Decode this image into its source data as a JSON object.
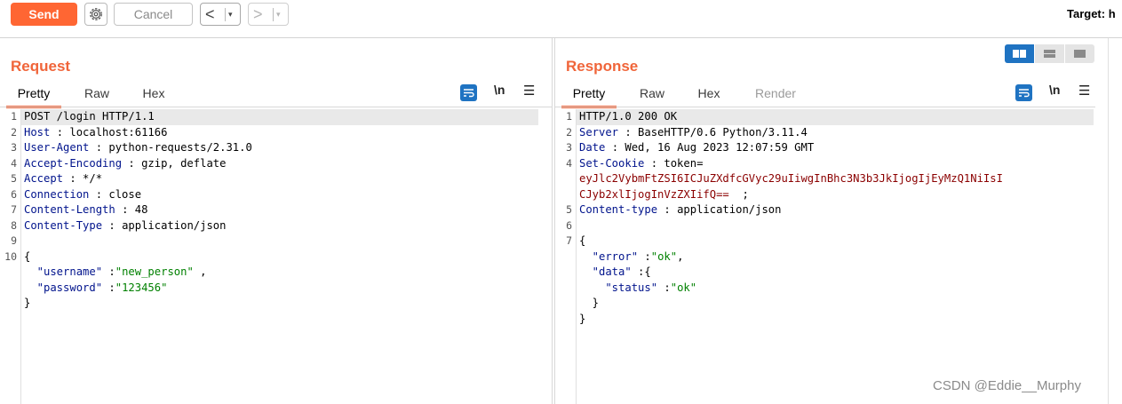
{
  "toolbar": {
    "send_label": "Send",
    "cancel_label": "Cancel",
    "back_arrow": "<",
    "forward_arrow": ">",
    "caret": "▾",
    "target_label": "Target: h"
  },
  "request": {
    "title": "Request",
    "tabs": [
      "Pretty",
      "Raw",
      "Hex"
    ],
    "nl_label": "\\n",
    "menu_label": "☰",
    "line_numbers": [
      "1",
      "2",
      "3",
      "4",
      "5",
      "6",
      "7",
      "8",
      "9",
      "10"
    ]
  },
  "response": {
    "title": "Response",
    "tabs": [
      "Pretty",
      "Raw",
      "Hex",
      "Render"
    ],
    "nl_label": "\\n",
    "menu_label": "☰",
    "line_numbers": [
      "1",
      "2",
      "3",
      "4",
      "",
      "",
      "5",
      "6",
      "7"
    ]
  },
  "req_lines": {
    "l1": "POST /login HTTP/1.1",
    "l2k": "Host",
    "l2v": " : localhost:61166",
    "l3k": "User-Agent",
    "l3v": " : python-requests/2.31.0",
    "l4k": "Accept-Encoding",
    "l4v": " : gzip, deflate",
    "l5k": "Accept",
    "l5v": " : */*",
    "l6k": "Connection",
    "l6v": " : close",
    "l7k": "Content-Length",
    "l7v": " : 48",
    "l8k": "Content-Type",
    "l8v": " : application/json",
    "l10": "{",
    "l11k": "  \"username\"",
    "l11c": " :",
    "l11v": "\"new_person\"",
    "l11e": " ,",
    "l12k": "  \"password\"",
    "l12c": " :",
    "l12v": "\"123456\"",
    "l13": "}"
  },
  "resp_lines": {
    "l1": "HTTP/1.0 200 OK",
    "l2k": "Server",
    "l2v": " : BaseHTTP/0.6 Python/3.11.4",
    "l3k": "Date",
    "l3v": " : Wed, 16 Aug 2023 12:07:59 GMT",
    "l4k": "Set-Cookie",
    "l4v": " : token=",
    "l4b": "eyJlc2VybmFtZSI6ICJuZXdfcGVyc29uIiwgInBhc3N3b3JkIjogIjEyMzQ1NiIsI",
    "l4c": "CJyb2xlIjogInVzZXIifQ==",
    "l4d": "  ;",
    "l5k": "Content-type",
    "l5v": " : application/json",
    "l7": "{",
    "l8k": "  \"error\"",
    "l8c": " :",
    "l8v": "\"ok\"",
    "l8e": ",",
    "l9k": "  \"data\"",
    "l9c": " :{",
    "l10k": "    \"status\"",
    "l10c": " :",
    "l10v": "\"ok\"",
    "l11": "  }",
    "l12": "}"
  },
  "watermark": "CSDN @Eddie__Murphy",
  "colors": {
    "accent": "#f0653a",
    "send": "#ff6633",
    "icon_blue": "#1f73c2",
    "header_key": "#00138c",
    "json_string": "#008000",
    "cookie_value": "#8b0000"
  }
}
